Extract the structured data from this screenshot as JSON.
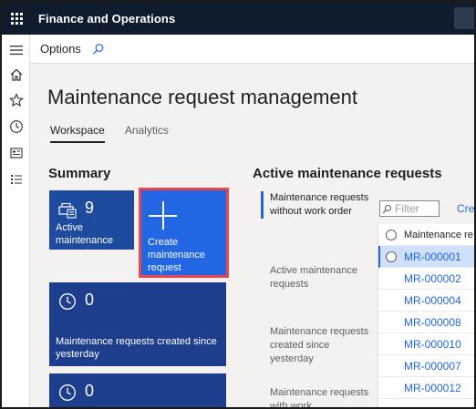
{
  "app": {
    "title": "Finance and Operations"
  },
  "toolbar": {
    "options_label": "Options"
  },
  "page": {
    "title": "Maintenance request management"
  },
  "tabs": [
    {
      "label": "Workspace",
      "active": true
    },
    {
      "label": "Analytics",
      "active": false
    }
  ],
  "summary": {
    "heading": "Summary",
    "tiles": [
      {
        "count": "9",
        "label": "Active maintenance requests",
        "icon": "printer-icon"
      },
      {
        "count": "",
        "label": "Create maintenance request",
        "icon": "plus-icon"
      },
      {
        "count": "0",
        "label": "Maintenance requests created since yesterday",
        "icon": "clock-icon"
      },
      {
        "count": "0",
        "label": "",
        "icon": "clock-icon"
      }
    ]
  },
  "active_requests": {
    "heading": "Active maintenance requests",
    "views": [
      {
        "label": "Maintenance requests without work order",
        "selected": true
      },
      {
        "label": "Active maintenance requests",
        "selected": false
      },
      {
        "label": "Maintenance requests created since yesterday",
        "selected": false
      },
      {
        "label": "Maintenance requests with work",
        "selected": false
      }
    ],
    "filter_placeholder": "Filter",
    "create_link": "Crea",
    "column_header": "Maintenance re",
    "rows": [
      "MR-000001",
      "MR-000002",
      "MR-000004",
      "MR-000008",
      "MR-000010",
      "MR-000007",
      "MR-000012"
    ]
  },
  "colors": {
    "appbar": "#0f1c2e",
    "tile_dark": "#1c3e8c",
    "tile_create": "#2266e3",
    "highlight_outline": "#e8484d",
    "link": "#2266e3"
  }
}
